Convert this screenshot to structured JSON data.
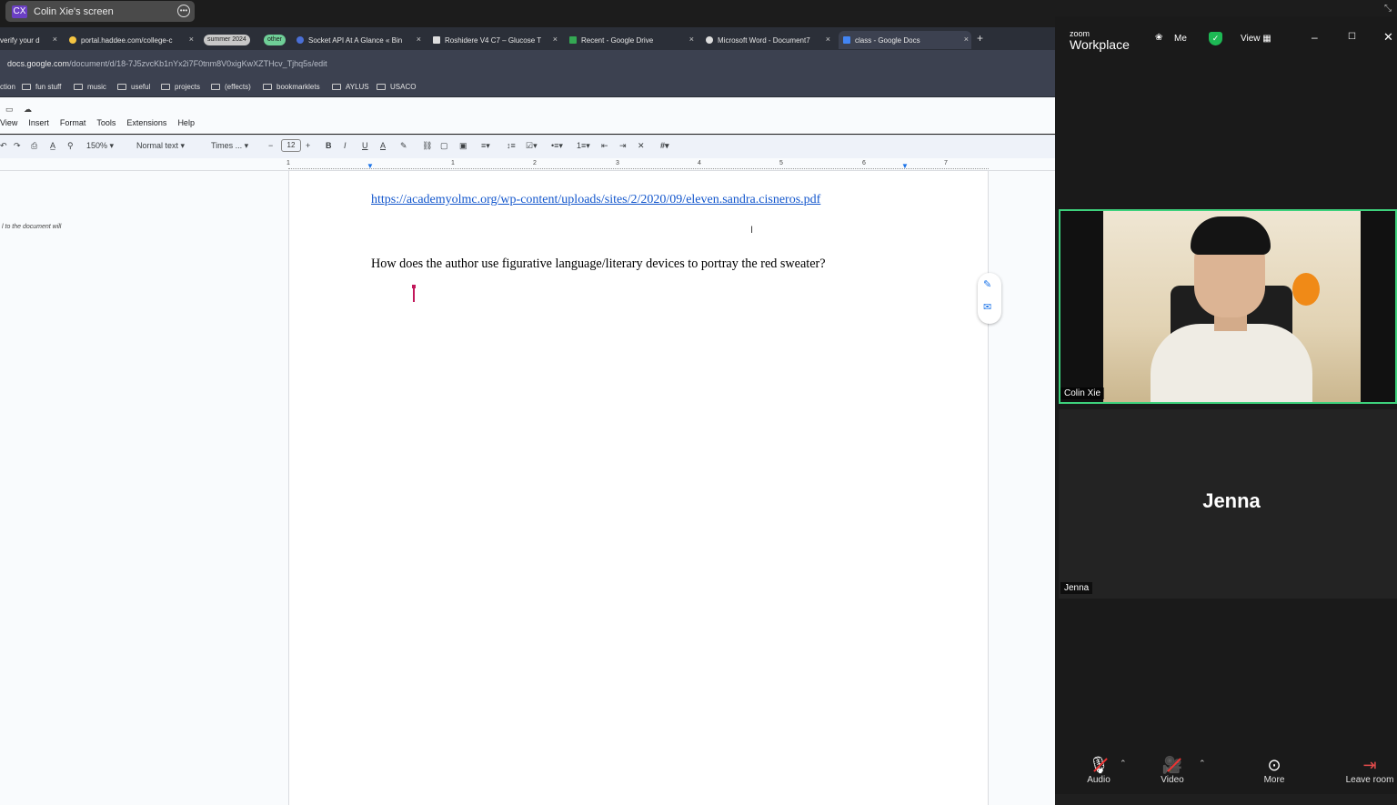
{
  "share_bar": {
    "initials": "CX",
    "label": "Colin Xie's screen",
    "more_icon": "ellipsis-icon",
    "collapse_icon": "collapse-icon"
  },
  "tabs": [
    {
      "label": "verify your d",
      "icon": "globe-icon"
    },
    {
      "label": "portal.haddee.com/college-c",
      "icon": "circle-icon"
    },
    {
      "label": "summer 2024",
      "type": "group-chip",
      "color": "#c7c7c7"
    },
    {
      "label": "other",
      "type": "group-chip",
      "color": "#6fcf97"
    },
    {
      "label": "Socket API At A Glance « Bin",
      "icon": "circle-icon"
    },
    {
      "label": "Roshidere V4 C7 – Glucose T",
      "icon": "page-icon"
    },
    {
      "label": "Recent - Google Drive",
      "icon": "drive-icon"
    },
    {
      "label": "Microsoft Word - Document7",
      "icon": "github-icon"
    },
    {
      "label": "class - Google Docs",
      "icon": "docs-icon",
      "active": true
    }
  ],
  "url": {
    "host": "docs.google.com",
    "path": "/document/d/18-7J5zvcKb1nYx2i7F0tnm8V0xigKwXZTHcv_Tjhq5s/edit"
  },
  "bookmarks": [
    "ction",
    "fun stuff",
    "music",
    "useful",
    "projects",
    "(effects)",
    "bookmarklets",
    "AYLUS",
    "USACO"
  ],
  "docs": {
    "menu": [
      "View",
      "Insert",
      "Format",
      "Tools",
      "Extensions",
      "Help"
    ],
    "toolbar": {
      "zoom": "150%",
      "style": "Normal text",
      "font": "Times ...",
      "font_size": "12"
    },
    "ruler_numbers": [
      "1",
      "1",
      "2",
      "3",
      "4",
      "5",
      "6",
      "7"
    ],
    "outline_note": "l to the document will",
    "link": "https://academyolmc.org/wp-content/uploads/sites/2/2020/09/eleven.sandra.cisneros.pdf",
    "question": "How does the author use figurative language/literary devices to portray the red sweater?"
  },
  "zoom": {
    "brand_small": "zoom",
    "brand": "Workplace",
    "header_buttons": [
      "Me",
      "View"
    ],
    "participants": [
      {
        "name": "Colin Xie",
        "video": true
      },
      {
        "name": "Jenna",
        "video": false,
        "display": "Jenna"
      }
    ],
    "controls": [
      "Audio",
      "Video",
      "More",
      "Leave room"
    ],
    "accent": "#3dd17c"
  }
}
